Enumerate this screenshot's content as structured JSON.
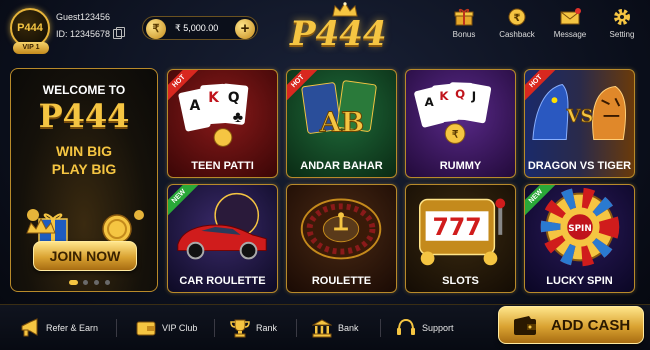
{
  "header": {
    "avatar_logo": "P444",
    "vip_label": "VIP 1",
    "username": "Guest123456",
    "user_id": "ID: 12345678",
    "balance": "₹ 5,000.00",
    "rupee_symbol": "₹",
    "add_symbol": "+",
    "brand": "P444",
    "actions": [
      {
        "label": "Bonus",
        "icon": "gift-icon"
      },
      {
        "label": "Cashback",
        "icon": "cashback-coin-icon"
      },
      {
        "label": "Message",
        "icon": "envelope-icon"
      },
      {
        "label": "Setting",
        "icon": "gear-icon"
      }
    ]
  },
  "banner": {
    "welcome": "WELCOME TO",
    "brand": "P444",
    "line1": "WIN BIG",
    "line2": "PLAY BIG",
    "cta": "JOIN NOW",
    "slides": 4,
    "active_slide": 1
  },
  "games": [
    {
      "label": "TEEN PATTI",
      "badge": "HOT"
    },
    {
      "label": "ANDAR BAHAR",
      "badge": "HOT",
      "art_text": "AB"
    },
    {
      "label": "RUMMY",
      "badge": ""
    },
    {
      "label": "DRAGON VS TIGER",
      "badge": "HOT",
      "art_text": "VS"
    },
    {
      "label": "CAR ROULETTE",
      "badge": "NEW"
    },
    {
      "label": "ROULETTE",
      "badge": ""
    },
    {
      "label": "SLOTS",
      "badge": "",
      "art_text": "777"
    },
    {
      "label": "LUCKY SPIN",
      "badge": "NEW",
      "art_text": "SPIN"
    }
  ],
  "card_ranks": [
    "A",
    "K",
    "Q",
    "J"
  ],
  "bottom_nav": [
    {
      "label": "Refer & Earn",
      "icon": "megaphone-icon"
    },
    {
      "label": "VIP Club",
      "icon": "vip-wallet-icon"
    },
    {
      "label": "Rank",
      "icon": "trophy-icon"
    },
    {
      "label": "Bank",
      "icon": "bank-icon"
    },
    {
      "label": "Support",
      "icon": "headset-icon"
    }
  ],
  "add_cash": "ADD CASH",
  "colors": {
    "gold": "#f5c542",
    "hot": "#d9281f",
    "new": "#2aa838",
    "background": "#0a0e1a"
  }
}
